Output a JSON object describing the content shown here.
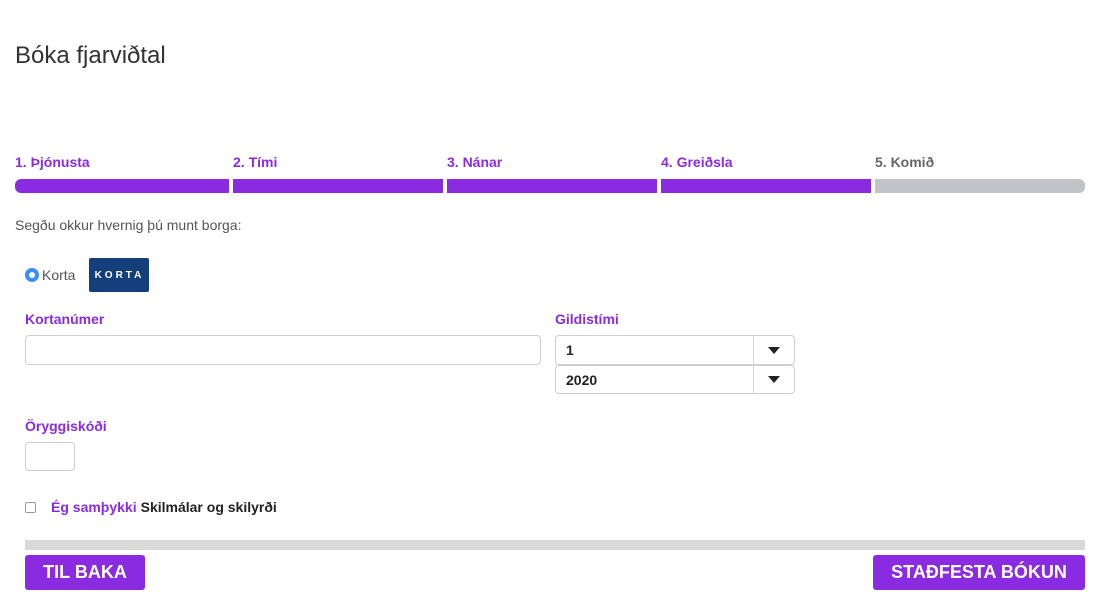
{
  "page": {
    "title": "Bóka fjarviðtal"
  },
  "steps": [
    {
      "label": "1. Þjónusta",
      "state": "done"
    },
    {
      "label": "2. Tími",
      "state": "done"
    },
    {
      "label": "3. Nánar",
      "state": "done"
    },
    {
      "label": "4. Greiðsla",
      "state": "done"
    },
    {
      "label": "5. Komið",
      "state": "todo"
    }
  ],
  "payment": {
    "prompt": "Segðu okkur hvernig þú munt borga:",
    "option_label": "Korta",
    "option_selected": true,
    "logo_text": "KORTA"
  },
  "form": {
    "card_number": {
      "label": "Kortanúmer",
      "value": "",
      "placeholder": ""
    },
    "expiry": {
      "label": "Gildistími",
      "month": "1",
      "year": "2020"
    },
    "cvc": {
      "label": "Öryggiskóði",
      "value": ""
    }
  },
  "terms": {
    "agree_text": "Ég samþykki",
    "link_text": "Skilmálar og skilyrði",
    "checked": false
  },
  "buttons": {
    "back": "TIL BAKA",
    "confirm": "STAÐFESTA BÓKUN"
  },
  "colors": {
    "accent": "#8a2be2",
    "inactive_step": "#c0c4c8",
    "radio": "#3b8ef3",
    "logo_bg": "#153f7a"
  }
}
